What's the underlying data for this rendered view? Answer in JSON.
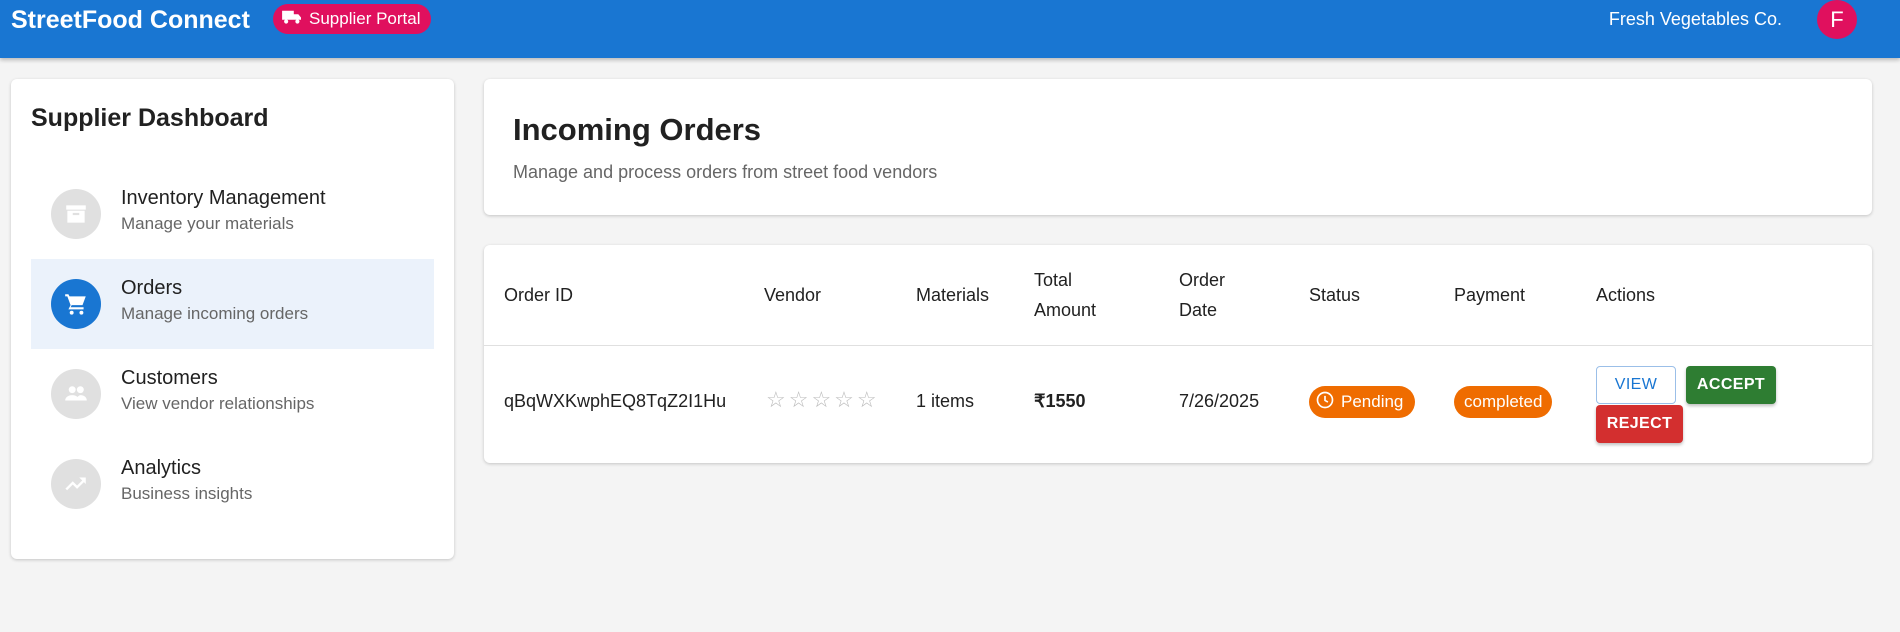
{
  "appbar": {
    "brand": "StreetFood Connect",
    "portal_chip": "Supplier Portal",
    "company": "Fresh Vegetables Co.",
    "avatar_initial": "F"
  },
  "sidebar": {
    "title": "Supplier Dashboard",
    "items": [
      {
        "label": "Inventory Management",
        "sub": "Manage your materials",
        "icon": "archive-icon",
        "active": false
      },
      {
        "label": "Orders",
        "sub": "Manage incoming orders",
        "icon": "cart-icon",
        "active": true
      },
      {
        "label": "Customers",
        "sub": "View vendor relationships",
        "icon": "people-icon",
        "active": false
      },
      {
        "label": "Analytics",
        "sub": "Business insights",
        "icon": "trending-up-icon",
        "active": false
      }
    ]
  },
  "header": {
    "title": "Incoming Orders",
    "subtitle": "Manage and process orders from street food vendors"
  },
  "table": {
    "headers": {
      "order_id": "Order ID",
      "vendor": "Vendor",
      "materials": "Materials",
      "total_1": "Total",
      "total_2": "Amount",
      "date_1": "Order",
      "date_2": "Date",
      "status": "Status",
      "payment": "Payment",
      "actions": "Actions"
    },
    "rows": [
      {
        "order_id": "qBqWXKwphEQ8TqZ2I1Hu",
        "vendor_rating": "☆☆☆☆☆",
        "materials": "1 items",
        "total": "₹1550",
        "date": "7/26/2025",
        "status": "Pending",
        "payment": "completed",
        "actions": {
          "view": "VIEW",
          "accept": "ACCEPT",
          "reject": "REJECT"
        }
      }
    ]
  },
  "colors": {
    "primary": "#1976d2",
    "accent_pink": "#e0105e",
    "status_orange": "#ef6c00",
    "accept_green": "#2e7d32",
    "reject_red": "#d32f2f"
  }
}
